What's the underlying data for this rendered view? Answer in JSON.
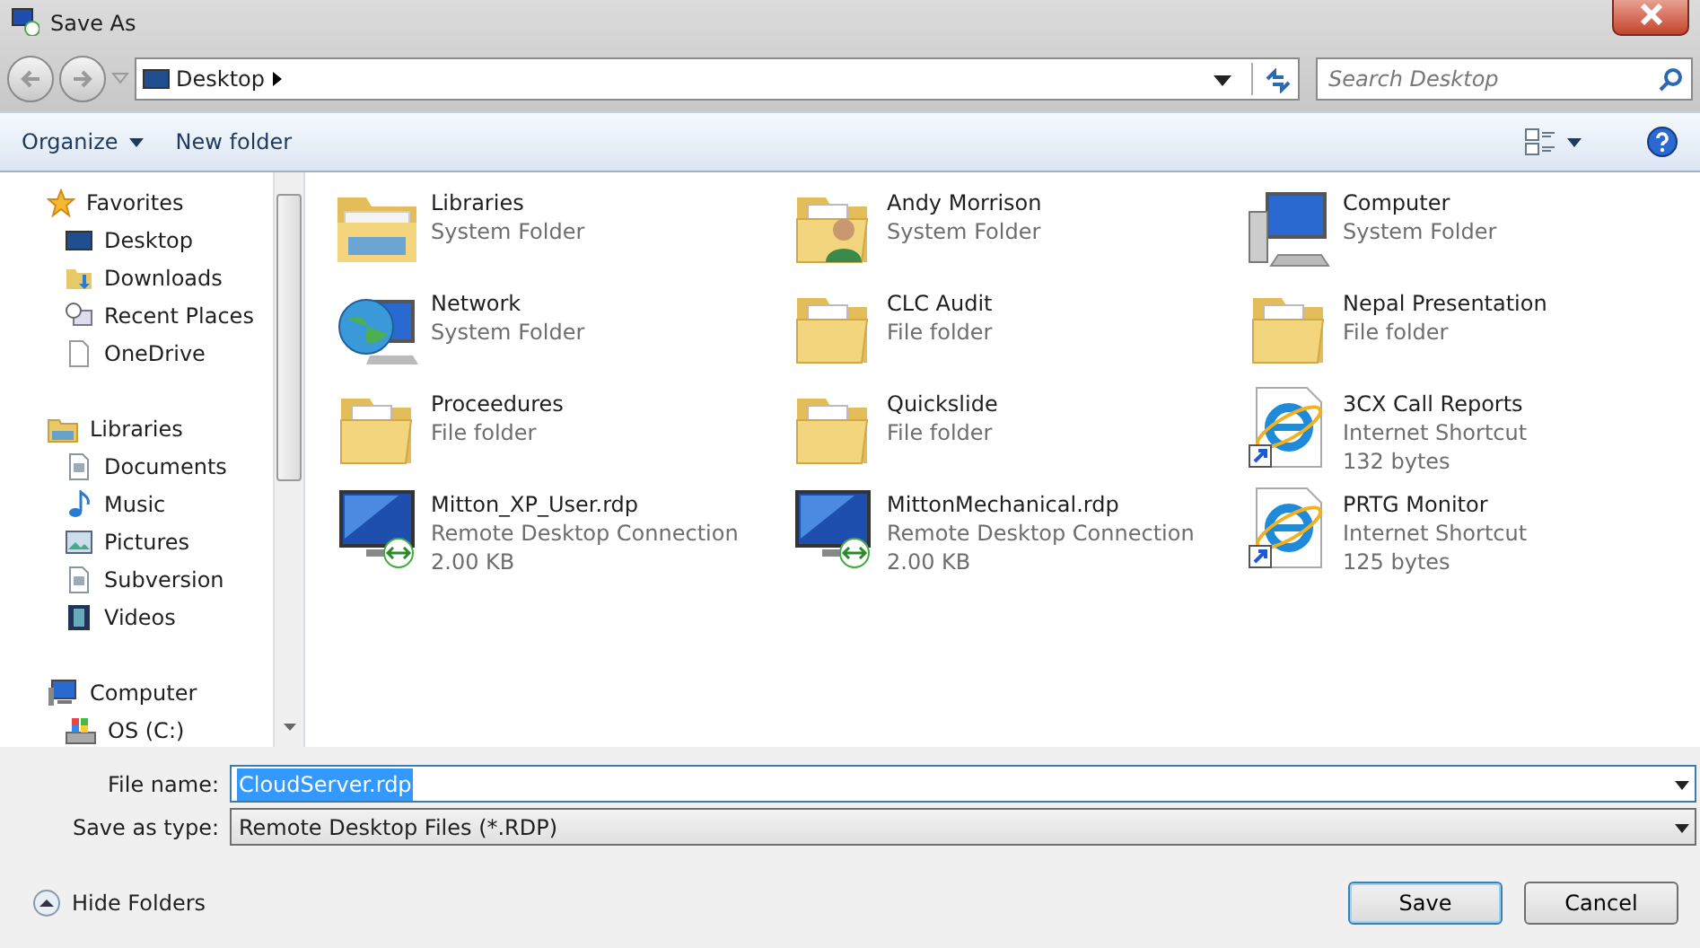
{
  "window": {
    "title": "Save As"
  },
  "address": {
    "location": "Desktop"
  },
  "search": {
    "placeholder": "Search Desktop"
  },
  "toolbar": {
    "organize": "Organize",
    "new_folder": "New folder"
  },
  "sidebar": {
    "groups": [
      {
        "label": "Favorites",
        "kind": "star",
        "children": [
          {
            "label": "Desktop",
            "kind": "desktop"
          },
          {
            "label": "Downloads",
            "kind": "downloads"
          },
          {
            "label": "Recent Places",
            "kind": "recent"
          },
          {
            "label": "OneDrive",
            "kind": "page"
          }
        ]
      },
      {
        "label": "Libraries",
        "kind": "library",
        "children": [
          {
            "label": "Documents",
            "kind": "document"
          },
          {
            "label": "Music",
            "kind": "music"
          },
          {
            "label": "Pictures",
            "kind": "picture"
          },
          {
            "label": "Subversion",
            "kind": "document"
          },
          {
            "label": "Videos",
            "kind": "video"
          }
        ]
      },
      {
        "label": "Computer",
        "kind": "computer",
        "children": [
          {
            "label": "OS (C:)",
            "kind": "drive"
          }
        ]
      }
    ]
  },
  "files": [
    {
      "name": "Libraries",
      "kind": "library",
      "details": [
        "System Folder"
      ]
    },
    {
      "name": "Andy Morrison",
      "kind": "user-folder",
      "details": [
        "System Folder"
      ]
    },
    {
      "name": "Computer",
      "kind": "computer",
      "details": [
        "System Folder"
      ]
    },
    {
      "name": "Network",
      "kind": "network",
      "details": [
        "System Folder"
      ]
    },
    {
      "name": "CLC Audit",
      "kind": "folder",
      "details": [
        "File folder"
      ]
    },
    {
      "name": "Nepal Presentation",
      "kind": "folder",
      "details": [
        "File folder"
      ]
    },
    {
      "name": "Proceedures",
      "kind": "folder",
      "details": [
        "File folder"
      ]
    },
    {
      "name": "Quickslide",
      "kind": "folder",
      "details": [
        "File folder"
      ]
    },
    {
      "name": "3CX Call Reports",
      "kind": "web-shortcut",
      "details": [
        "Internet Shortcut",
        "132 bytes"
      ]
    },
    {
      "name": "Mitton_XP_User.rdp",
      "kind": "rdp",
      "details": [
        "Remote Desktop Connection",
        "2.00 KB"
      ]
    },
    {
      "name": "MittonMechanical.rdp",
      "kind": "rdp",
      "details": [
        "Remote Desktop Connection",
        "2.00 KB"
      ]
    },
    {
      "name": "PRTG Monitor",
      "kind": "web-shortcut",
      "details": [
        "Internet Shortcut",
        "125 bytes"
      ]
    }
  ],
  "form": {
    "file_name_label": "File name:",
    "file_name": "CloudServer.rdp",
    "type_label": "Save as type:",
    "type": "Remote Desktop Files (*.RDP)"
  },
  "footer": {
    "hide_folders": "Hide Folders",
    "save": "Save",
    "cancel": "Cancel"
  }
}
